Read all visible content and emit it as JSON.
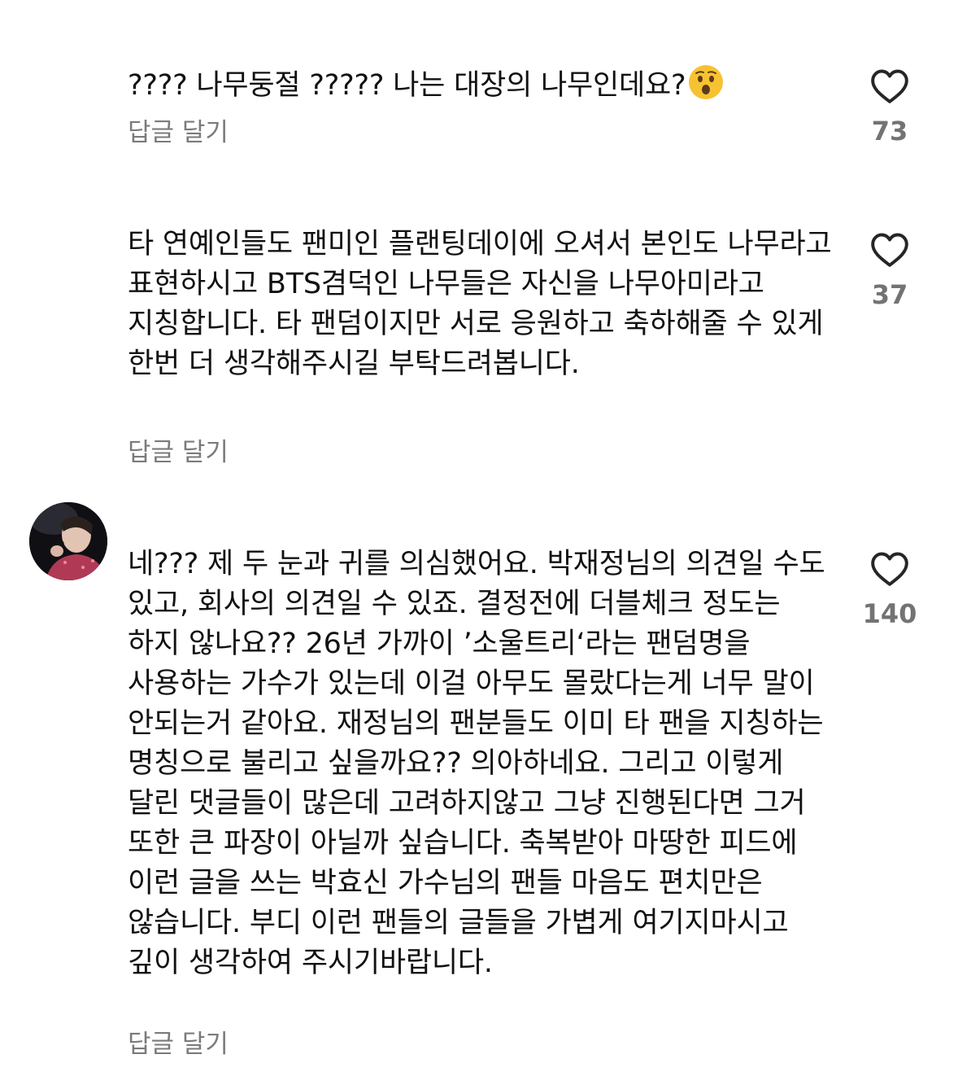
{
  "comments": [
    {
      "text": "???? 나무둥절 ????? 나는 대장의 나무인데요?",
      "emoji": "hushed-face-emoji",
      "reply_label": "답글 달기",
      "likes": "73",
      "has_avatar": false
    },
    {
      "text": "타 연예인들도 팬미인 플랜팅데이에 오셔서 본인도 나무라고 표현하시고 BTS겸덕인 나무들은 자신을 나무아미라고 지칭합니다. 타 팬덤이지만 서로 응원하고 축하해줄 수 있게 한번 더 생각해주시길 부탁드려봅니다.",
      "reply_label": "답글 달기",
      "likes": "37",
      "has_avatar": false
    },
    {
      "text": "네??? 제 두 눈과 귀를 의심했어요. 박재정님의 의견일 수도 있고, 회사의 의견일 수 있죠. 결정전에 더블체크 정도는 하지 않나요?? 26년 가까이 ’소울트리‘라는 팬덤명을 사용하는 가수가 있는데 이걸 아무도 몰랐다는게 너무 말이 안되는거 같아요. 재정님의 팬분들도 이미 타 팬을 지칭하는 명칭으로 불리고 싶을까요?? 의아하네요. 그리고 이렇게 달린 댓글들이 많은데 고려하지않고 그냥 진행된다면 그거 또한 큰 파장이 아닐까 싶습니다. 축복받아 마땅한 피드에 이런 글을 쓰는 박효신 가수님의 팬들 마음도 편치만은 않습니다. 부디 이런 팬들의 글들을 가볍게 여기지마시고 깊이 생각하여 주시기바랍니다.",
      "reply_label": "답글 달기",
      "likes": "140",
      "has_avatar": true,
      "avatar_icon": "user-avatar-singer-with-microphone"
    }
  ],
  "colors": {
    "text": "#111111",
    "secondary": "#7b7b7b",
    "count": "#737373"
  }
}
